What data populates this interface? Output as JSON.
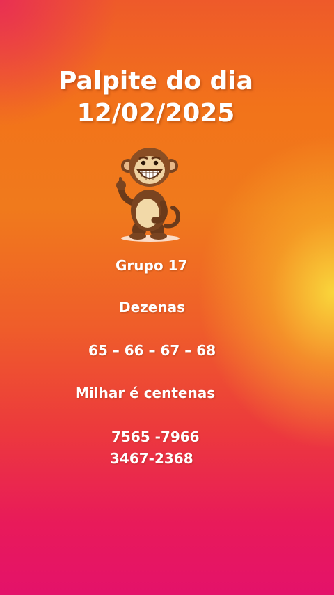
{
  "title": {
    "line1": "Palpite do dia",
    "line2": "12/02/2025"
  },
  "grupo": "Grupo 17",
  "dezenas": {
    "label": "Dezenas",
    "values": "65 – 66 – 67 – 68"
  },
  "milhar": {
    "label": "Milhar é centenas",
    "line1": "7565 -7966",
    "line2": "3467-2368"
  },
  "mascot": "monkey-mascot-icon",
  "colors": {
    "top": "#ee5a2a",
    "middle": "#f07a1c",
    "bottom": "#e4126a",
    "glow": "#fadc3c",
    "text": "#ffffff"
  }
}
